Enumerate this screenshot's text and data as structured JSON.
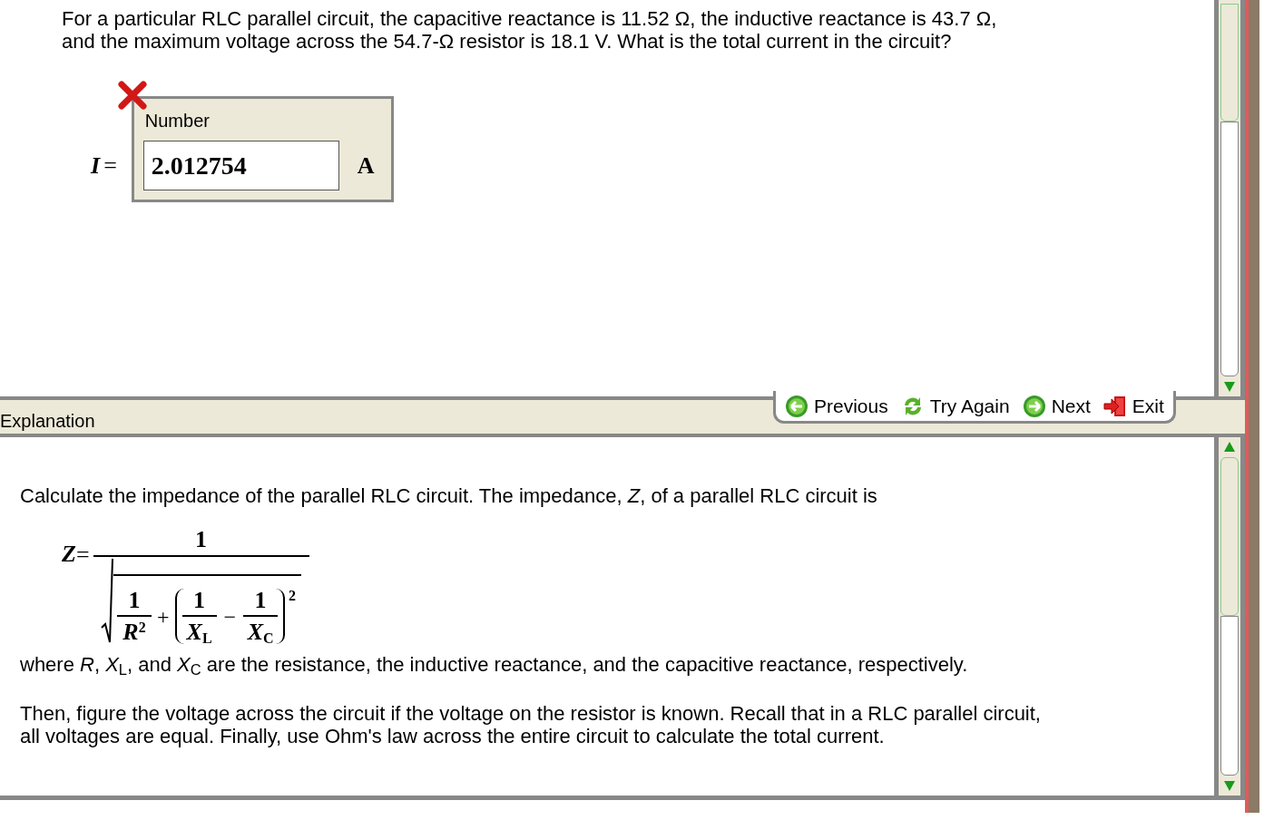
{
  "question": "For a particular RLC parallel circuit, the capacitive reactance is 11.52 Ω, the inductive reactance is 43.7 Ω,\nand the maximum voltage across the 54.7-Ω resistor is 18.1 V. What is the total current in the circuit?",
  "answer": {
    "variable": "I",
    "equals": "=",
    "label": "Number",
    "value": "2.012754",
    "unit": "A",
    "correct": false
  },
  "nav_buttons": [
    {
      "kind": "previous",
      "label": "Previous"
    },
    {
      "kind": "try_again",
      "label": "Try Again"
    },
    {
      "kind": "next",
      "label": "Next"
    },
    {
      "kind": "exit",
      "label": "Exit"
    }
  ],
  "explanation_tab": "Explanation",
  "explanation": {
    "intro": "Calculate the impedance of the parallel RLC circuit. The impedance, *Z*,  of a parallel RLC circuit is",
    "formula": {
      "lhs": "Z",
      "equals": "=",
      "numerator": "1",
      "r_term": {
        "num": "1",
        "den": "R",
        "exp": "2"
      },
      "plus": "+",
      "xl_term": {
        "num": "1",
        "den": "X",
        "sub": "L"
      },
      "minus": "−",
      "xc_term": {
        "num": "1",
        "den": "X",
        "sub": "C"
      },
      "outer_exp": "2"
    },
    "where": "where *R*, *X*$_{L}$, and *X*$_{C}$ are the resistance, the inductive reactance, and the capacitive reactance, respectively.",
    "final": "Then, figure the voltage across the circuit if the voltage on the resistor is known. Recall that in a RLC parallel circuit,\nall voltages are equal. Finally, use Ohm's law across the entire circuit to calculate the total current."
  }
}
